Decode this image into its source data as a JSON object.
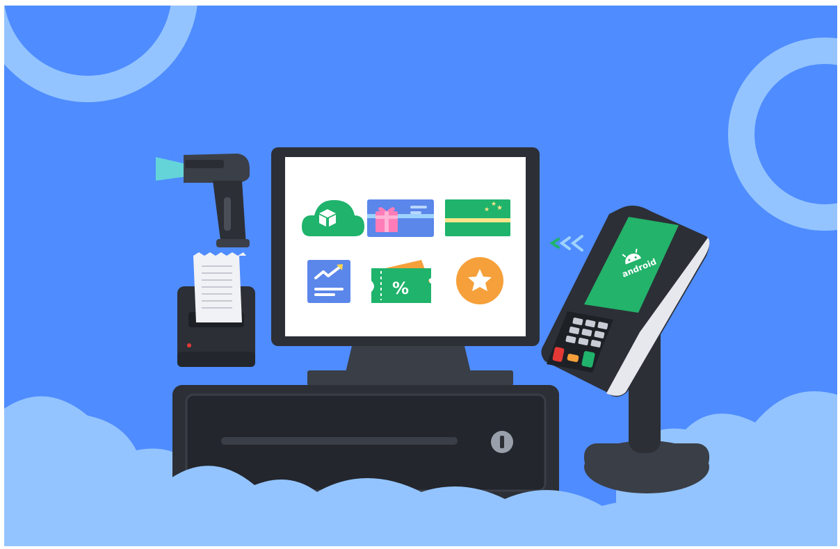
{
  "colors": {
    "background": "#4f8cff",
    "cloud": "#93c4ff",
    "ring": "#93c4ff",
    "device_dark": "#2c2f36",
    "device_mid": "#3a3e46",
    "screen": "#ffffff",
    "green": "#1fb36b",
    "orange": "#f5a03a",
    "card_blue": "#5b86ea",
    "chart_blue": "#5b86ea",
    "terminal_screen": "#23b36a"
  },
  "icons": [
    "cloud-box-icon",
    "gift-card-icon",
    "green-card-stars-icon",
    "chart-report-icon",
    "discount-coupon-icon",
    "star-badge-icon"
  ],
  "terminal": {
    "screen_label": "android"
  }
}
